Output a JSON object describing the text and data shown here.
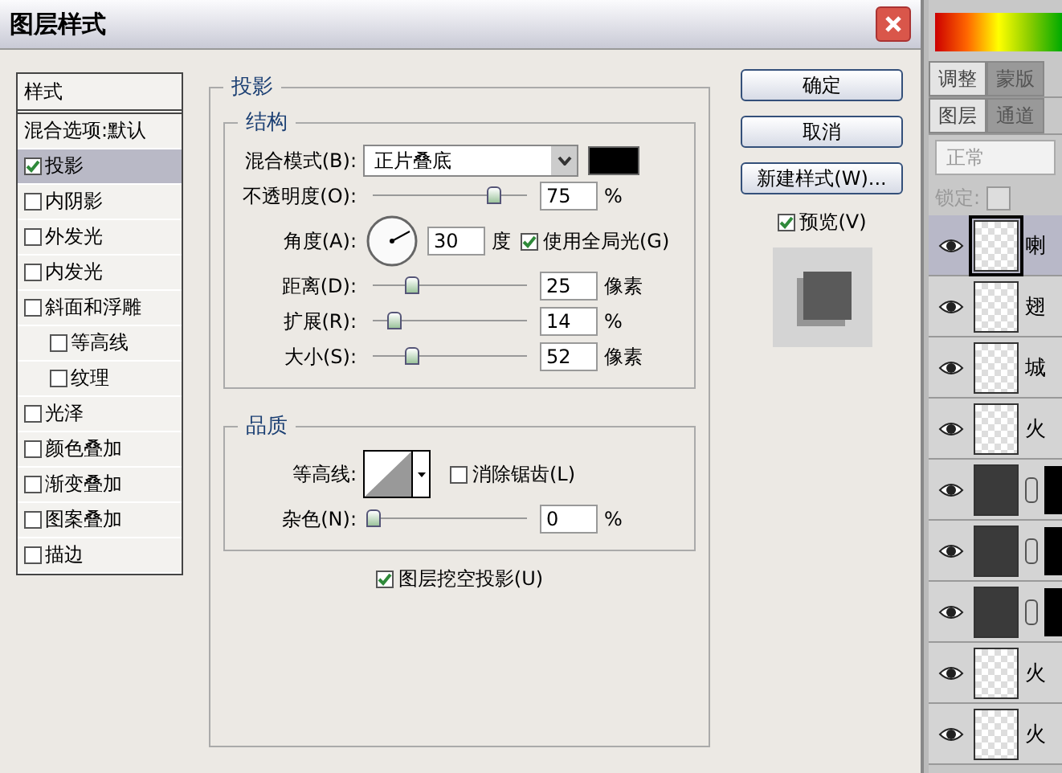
{
  "dialog": {
    "title": "图层样式"
  },
  "styles_list": {
    "header": "样式",
    "items": [
      {
        "label": "混合选项:默认",
        "kind": "plain",
        "selected": false
      },
      {
        "label": "投影",
        "kind": "check",
        "checked": true,
        "selected": true
      },
      {
        "label": "内阴影",
        "kind": "check",
        "checked": false,
        "selected": false
      },
      {
        "label": "外发光",
        "kind": "check",
        "checked": false,
        "selected": false
      },
      {
        "label": "内发光",
        "kind": "check",
        "checked": false,
        "selected": false
      },
      {
        "label": "斜面和浮雕",
        "kind": "check",
        "checked": false,
        "selected": false,
        "children": [
          {
            "label": "等高线",
            "kind": "check",
            "checked": false,
            "selected": false
          },
          {
            "label": "纹理",
            "kind": "check",
            "checked": false,
            "selected": false
          }
        ]
      },
      {
        "label": "光泽",
        "kind": "check",
        "checked": false,
        "selected": false
      },
      {
        "label": "颜色叠加",
        "kind": "check",
        "checked": false,
        "selected": false
      },
      {
        "label": "渐变叠加",
        "kind": "check",
        "checked": false,
        "selected": false
      },
      {
        "label": "图案叠加",
        "kind": "check",
        "checked": false,
        "selected": false
      },
      {
        "label": "描边",
        "kind": "check",
        "checked": false,
        "selected": false
      }
    ]
  },
  "drop_shadow": {
    "title": "投影",
    "structure": {
      "title": "结构",
      "blend_mode": {
        "label": "混合模式(B):",
        "value": "正片叠底"
      },
      "opacity": {
        "label": "不透明度(O):",
        "level": 0.78,
        "value": "75",
        "unit": "%"
      },
      "angle": {
        "label": "角度(A):",
        "value": "30",
        "unit": "度"
      },
      "global_light": {
        "label": "使用全局光(G)",
        "checked": true
      },
      "distance": {
        "label": "距离(D):",
        "level": 0.25,
        "value": "25",
        "unit": "像素"
      },
      "spread": {
        "label": "扩展(R):",
        "level": 0.14,
        "value": "14",
        "unit": "%"
      },
      "size": {
        "label": "大小(S):",
        "level": 0.25,
        "value": "52",
        "unit": "像素"
      }
    },
    "quality": {
      "title": "品质",
      "contour": {
        "label": "等高线:"
      },
      "anti_alias": {
        "label": "消除锯齿(L)",
        "checked": false
      },
      "noise": {
        "label": "杂色(N):",
        "level": 0,
        "value": "0",
        "unit": "%"
      }
    },
    "knockout": {
      "label": "图层挖空投影(U)",
      "checked": true
    }
  },
  "buttons": [
    {
      "label": "确定"
    },
    {
      "label": "取消"
    },
    {
      "label": "新建样式(W)..."
    }
  ],
  "preview": {
    "label": "预览(V)",
    "checked": true
  },
  "layers_panel": {
    "upper_tabs": [
      {
        "label": "调整",
        "selected": true
      },
      {
        "label": "蒙版",
        "selected": false
      }
    ],
    "tabs": [
      {
        "label": "图层",
        "selected": true
      },
      {
        "label": "通道",
        "selected": false
      }
    ],
    "blend_mode": "正常",
    "lock_label": "锁定:",
    "layers": [
      {
        "name": "喇",
        "kind": "plain",
        "visible": true,
        "selected": true
      },
      {
        "name": "翅",
        "kind": "plain",
        "visible": true,
        "selected": false
      },
      {
        "name": "城",
        "kind": "plain",
        "visible": true,
        "selected": false
      },
      {
        "name": "火",
        "kind": "plain",
        "visible": true,
        "selected": false
      },
      {
        "kind": "masked",
        "visible": true,
        "selected": false
      },
      {
        "kind": "masked",
        "visible": true,
        "selected": false
      },
      {
        "kind": "masked",
        "visible": true,
        "selected": false
      },
      {
        "name": "火",
        "kind": "plain",
        "visible": true,
        "selected": false
      },
      {
        "name": "火",
        "kind": "plain",
        "visible": true,
        "selected": false
      }
    ]
  }
}
